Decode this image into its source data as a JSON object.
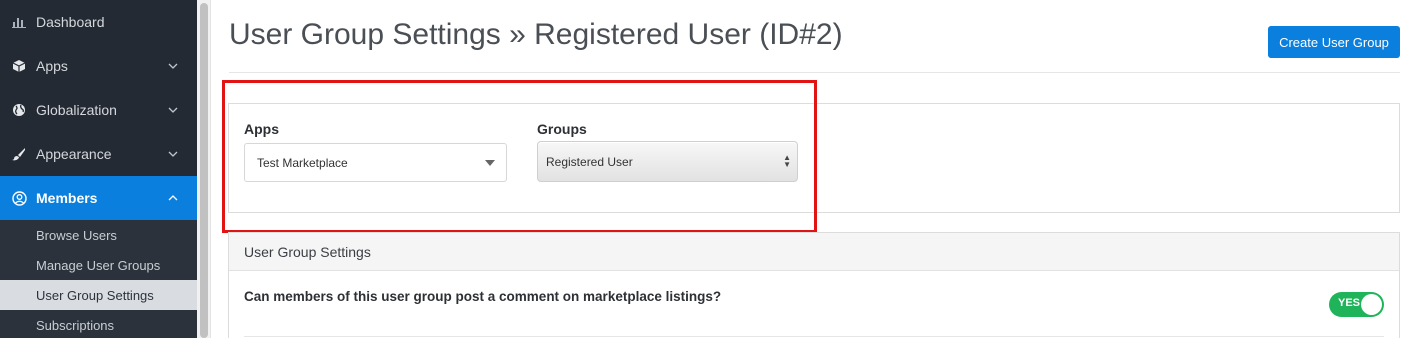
{
  "sidebar": {
    "items": [
      {
        "label": "Dashboard",
        "icon": "chart-bars-icon"
      },
      {
        "label": "Apps",
        "icon": "cube-icon"
      },
      {
        "label": "Globalization",
        "icon": "globe-icon"
      },
      {
        "label": "Appearance",
        "icon": "paint-brush-icon"
      },
      {
        "label": "Members",
        "icon": "user-circle-icon"
      }
    ],
    "sub_items": [
      {
        "label": "Browse Users"
      },
      {
        "label": "Manage User Groups"
      },
      {
        "label": "User Group Settings"
      },
      {
        "label": "Subscriptions"
      }
    ]
  },
  "header": {
    "title": "User Group Settings » Registered User (ID#2)",
    "create_button": "Create User Group"
  },
  "filters": {
    "apps_label": "Apps",
    "apps_value": "Test Marketplace",
    "groups_label": "Groups",
    "groups_value": "Registered User"
  },
  "settings": {
    "header": "User Group Settings",
    "question": "Can members of this user group post a comment on marketplace listings?",
    "toggle_label": "YES"
  },
  "colors": {
    "accent": "#0a7fdd",
    "sidebar_bg": "#232a33",
    "toggle_on": "#1fb45a",
    "highlight": "#e11313"
  }
}
